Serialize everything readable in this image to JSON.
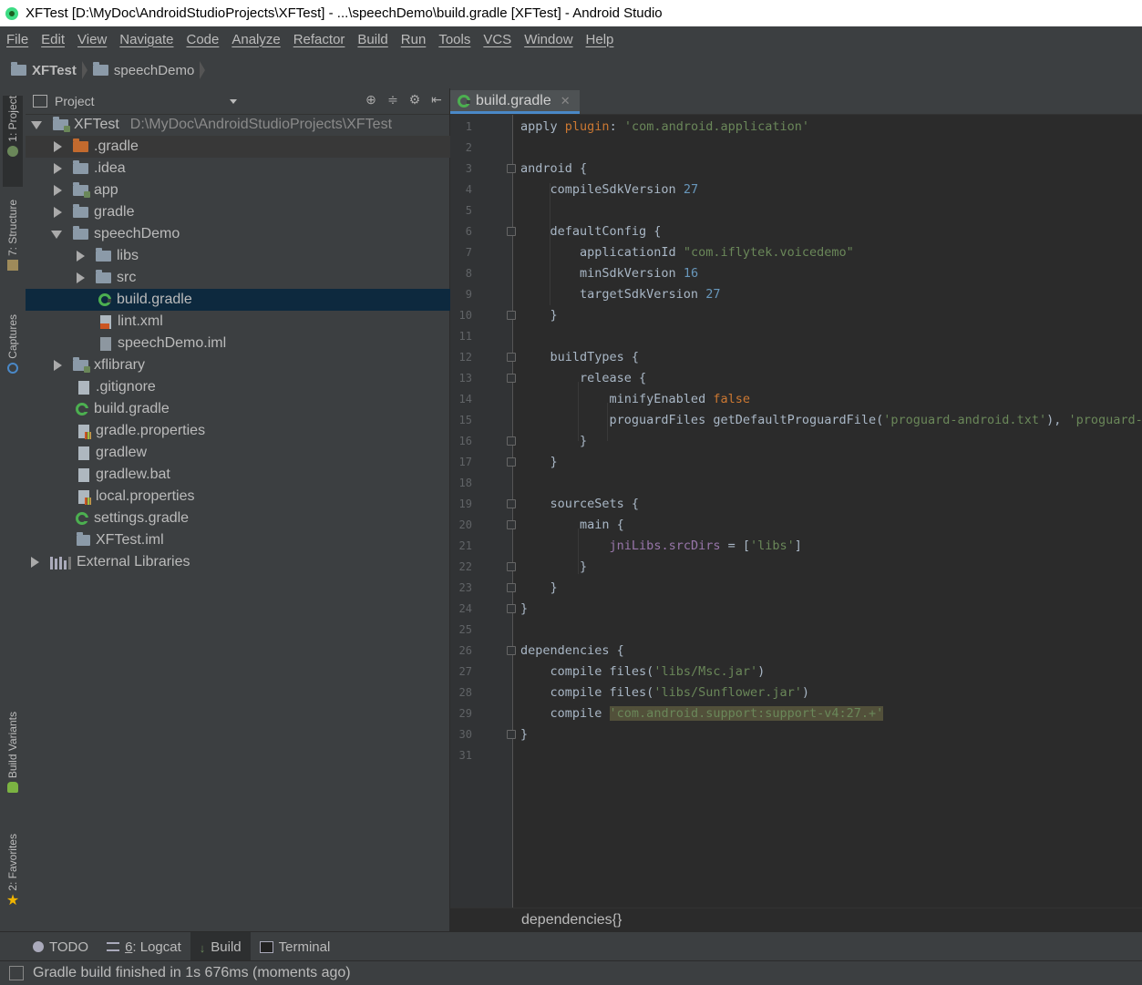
{
  "window": {
    "title": "XFTest [D:\\MyDoc\\AndroidStudioProjects\\XFTest] - ...\\speechDemo\\build.gradle [XFTest] - Android Studio"
  },
  "menu": [
    "File",
    "Edit",
    "View",
    "Navigate",
    "Code",
    "Analyze",
    "Refactor",
    "Build",
    "Run",
    "Tools",
    "VCS",
    "Window",
    "Help"
  ],
  "breadcrumb": {
    "project": "XFTest",
    "module": "speechDemo"
  },
  "left_tabs": {
    "project": "1: Project",
    "structure": "7: Structure",
    "captures": "Captures",
    "build_variants": "Build Variants",
    "favorites": "2: Favorites"
  },
  "project_panel": {
    "view_mode": "Project",
    "tree": [
      {
        "label": "XFTest",
        "path": "D:\\MyDoc\\AndroidStudioProjects\\XFTest"
      },
      {
        "label": ".gradle"
      },
      {
        "label": ".idea"
      },
      {
        "label": "app"
      },
      {
        "label": "gradle"
      },
      {
        "label": "speechDemo"
      },
      {
        "label": "libs"
      },
      {
        "label": "src"
      },
      {
        "label": "build.gradle"
      },
      {
        "label": "lint.xml"
      },
      {
        "label": "speechDemo.iml"
      },
      {
        "label": "xflibrary"
      },
      {
        "label": ".gitignore"
      },
      {
        "label": "build.gradle"
      },
      {
        "label": "gradle.properties"
      },
      {
        "label": "gradlew"
      },
      {
        "label": "gradlew.bat"
      },
      {
        "label": "local.properties"
      },
      {
        "label": "settings.gradle"
      },
      {
        "label": "XFTest.iml"
      },
      {
        "label": "External Libraries"
      }
    ]
  },
  "editor": {
    "tab_label": "build.gradle",
    "breadcrumb": "dependencies{}",
    "line_numbers": [
      "1",
      "2",
      "3",
      "4",
      "5",
      "6",
      "7",
      "8",
      "9",
      "10",
      "11",
      "12",
      "13",
      "14",
      "15",
      "16",
      "17",
      "18",
      "19",
      "20",
      "21",
      "22",
      "23",
      "24",
      "25",
      "26",
      "27",
      "28",
      "29",
      "30",
      "31"
    ],
    "code": {
      "l1a": "apply ",
      "l1b": "plugin",
      "l1c": ": ",
      "l1d": "'com.android.application'",
      "l3": "android {",
      "l4a": "    compileSdkVersion ",
      "l4b": "27",
      "l6": "    defaultConfig {",
      "l7a": "        applicationId ",
      "l7b": "\"com.iflytek.voicedemo\"",
      "l8a": "        minSdkVersion ",
      "l8b": "16",
      "l9a": "        targetSdkVersion ",
      "l9b": "27",
      "l10": "    }",
      "l12": "    buildTypes {",
      "l13": "        release {",
      "l14a": "            minifyEnabled ",
      "l14b": "false",
      "l15a": "            proguardFiles getDefaultProguardFile(",
      "l15b": "'proguard-android.txt'",
      "l15c": "), ",
      "l15d": "'proguard-ru",
      "l16": "        }",
      "l17": "    }",
      "l19": "    sourceSets {",
      "l20": "        main {",
      "l21a": "            ",
      "l21b": "jniLibs.srcDirs",
      "l21c": " = [",
      "l21d": "'libs'",
      "l21e": "]",
      "l22": "        }",
      "l23": "    }",
      "l24": "}",
      "l26": "dependencies {",
      "l27a": "    compile files(",
      "l27b": "'libs/Msc.jar'",
      "l27c": ")",
      "l28a": "    compile files(",
      "l28b": "'libs/Sunflower.jar'",
      "l28c": ")",
      "l29a": "    compile ",
      "l29b": "'com.android.support:support-v4:27.+'",
      "l30": "}"
    }
  },
  "bottom_tabs": {
    "todo": "TODO",
    "logcat_num": "6",
    "logcat": ": Logcat",
    "build": "Build",
    "terminal": "Terminal"
  },
  "status": {
    "message": "Gradle build finished in 1s 676ms (moments ago)"
  }
}
